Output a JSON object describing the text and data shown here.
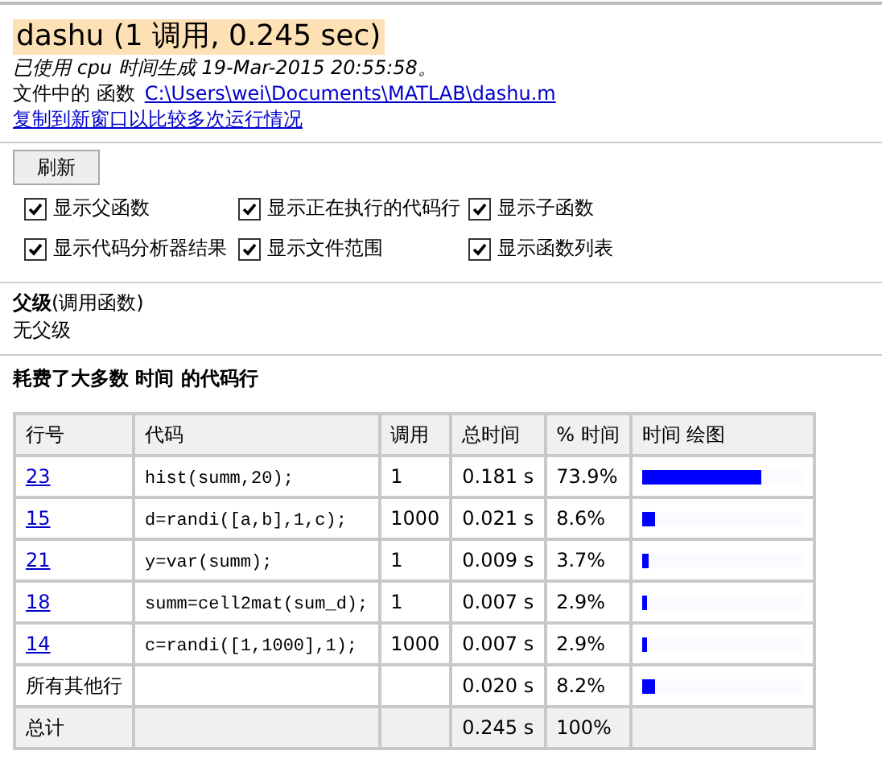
{
  "title": "dashu (1 调用, 0.245 sec)",
  "generated": "已使用 cpu 时间生成 19-Mar-2015 20:55:58。",
  "file_label": "文件中的 函数",
  "file_link": "C:\\Users\\wei\\Documents\\MATLAB\\dashu.m",
  "copy_link": "复制到新窗口以比较多次运行情况",
  "refresh_button": "刷新",
  "options": [
    {
      "label": "显示父函数",
      "checked": true
    },
    {
      "label": "显示正在执行的代码行",
      "checked": true
    },
    {
      "label": "显示子函数",
      "checked": true
    },
    {
      "label": "显示代码分析器结果",
      "checked": true
    },
    {
      "label": "显示文件范围",
      "checked": true
    },
    {
      "label": "显示函数列表",
      "checked": true
    }
  ],
  "parents": {
    "heading": "父级",
    "heading_note": "(调用函数)",
    "text": "无父级"
  },
  "lines_heading": "耗费了大多数 时间 的代码行",
  "table": {
    "columns": [
      "行号",
      "代码",
      "调用",
      "总时间",
      "% 时间",
      "时间 绘图"
    ],
    "rows": [
      {
        "kind": "line",
        "line": "23",
        "code": "hist(summ,20);",
        "calls": "1",
        "total": "0.181 s",
        "percent": "73.9%",
        "level": 0.739
      },
      {
        "kind": "line",
        "line": "15",
        "code": "d=randi([a,b],1,c);",
        "calls": "1000",
        "total": "0.021 s",
        "percent": "8.6%",
        "level": 0.086
      },
      {
        "kind": "line",
        "line": "21",
        "code": "y=var(summ);",
        "calls": "1",
        "total": "0.009 s",
        "percent": "3.7%",
        "level": 0.037
      },
      {
        "kind": "line",
        "line": "18",
        "code": "summ=cell2mat(sum_d);",
        "calls": "1",
        "total": "0.007 s",
        "percent": "2.9%",
        "level": 0.029
      },
      {
        "kind": "line",
        "line": "14",
        "code": "c=randi([1,1000],1);",
        "calls": "1000",
        "total": "0.007 s",
        "percent": "2.9%",
        "level": 0.029
      },
      {
        "kind": "other",
        "line": "所有其他行",
        "total": "0.020 s",
        "percent": "8.2%",
        "level": 0.082
      },
      {
        "kind": "total",
        "line": "总计",
        "total": "0.245 s",
        "percent": "100%"
      }
    ]
  }
}
